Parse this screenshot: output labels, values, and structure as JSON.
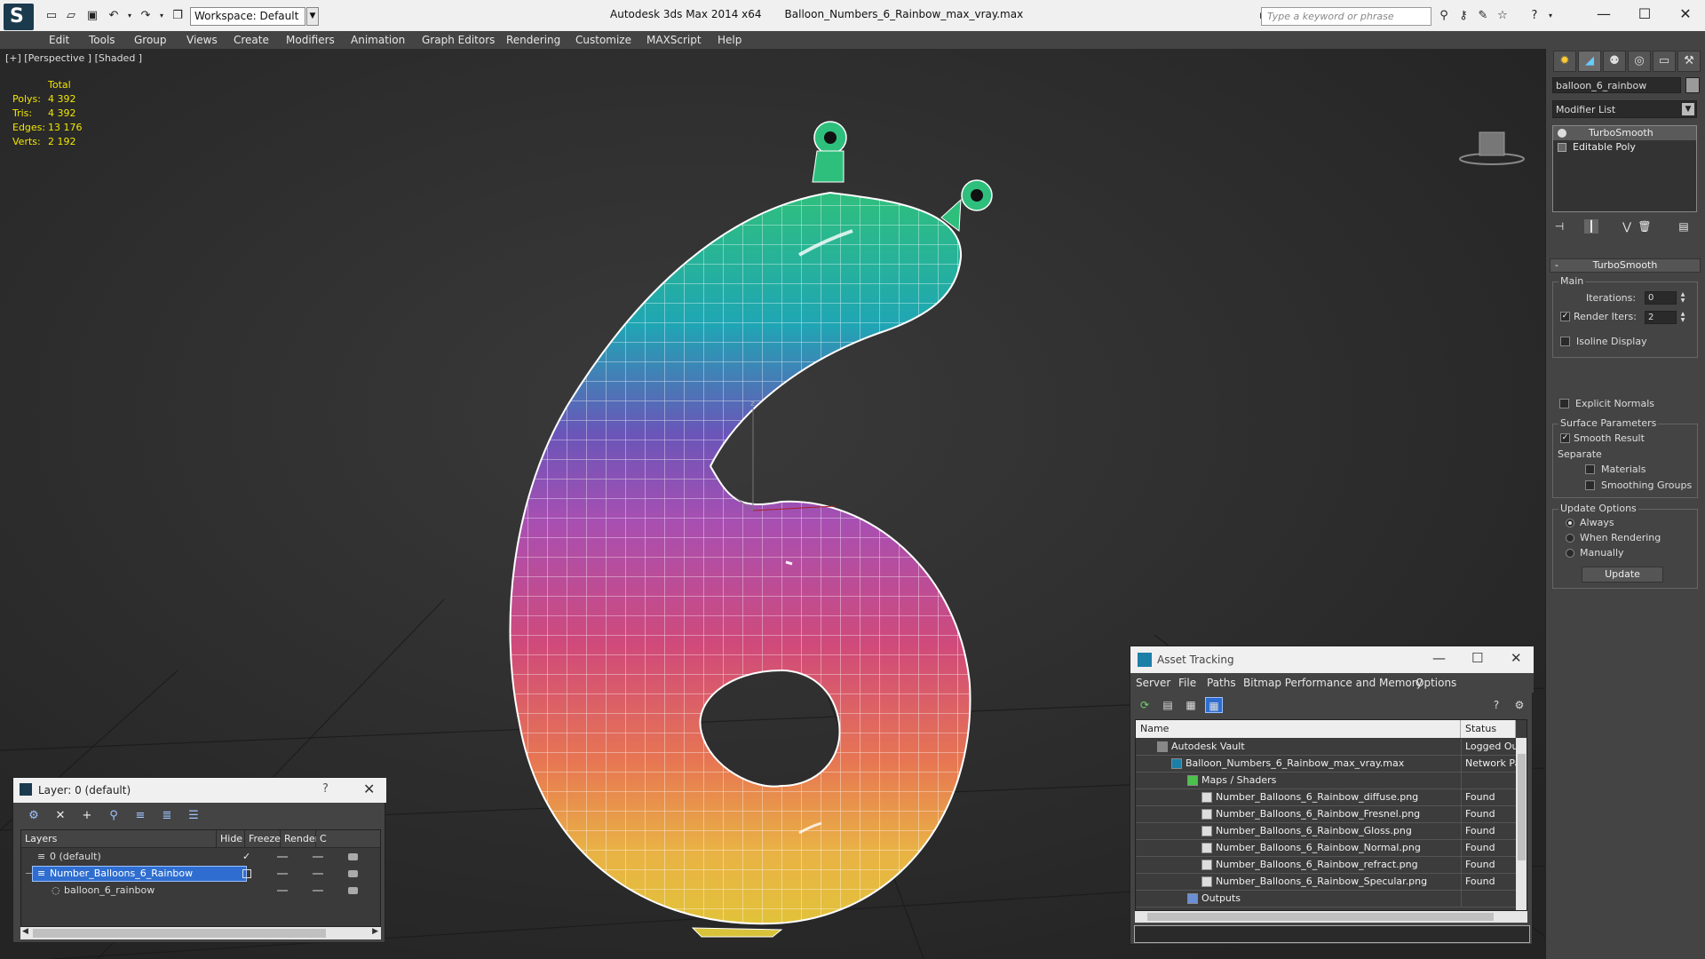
{
  "titlebar": {
    "workspace": "Workspace: Default",
    "app_name": "Autodesk 3ds Max  2014 x64",
    "file_name": "Balloon_Numbers_6_Rainbow_max_vray.max",
    "search_placeholder": "Type a keyword or phrase"
  },
  "menu": [
    "Edit",
    "Tools",
    "Group",
    "Views",
    "Create",
    "Modifiers",
    "Animation",
    "Graph Editors",
    "Rendering",
    "Customize",
    "MAXScript",
    "Help"
  ],
  "viewport": {
    "label": "[+] [Perspective ] [Shaded ]",
    "stats_header": "Total",
    "stats": [
      {
        "key": "Polys:",
        "value": "4 392"
      },
      {
        "key": "Tris:",
        "value": "4 392"
      },
      {
        "key": "Edges:",
        "value": "13 176"
      },
      {
        "key": "Verts:",
        "value": "2 192"
      }
    ],
    "gizmo_axis": "z"
  },
  "command_panel": {
    "object_name": "balloon_6_rainbow",
    "modifier_list": "Modifier List",
    "stack": [
      "TurboSmooth",
      "Editable Poly"
    ],
    "rollout_title": "TurboSmooth",
    "main_group": "Main",
    "iterations_label": "Iterations:",
    "iterations_value": "0",
    "render_iters_label": "Render Iters:",
    "render_iters_value": "2",
    "isoline_display": "Isoline Display",
    "explicit_normals": "Explicit Normals",
    "surface_group": "Surface Parameters",
    "smooth_result": "Smooth Result",
    "separate_label": "Separate",
    "materials": "Materials",
    "smoothing_groups": "Smoothing Groups",
    "update_group": "Update Options",
    "always": "Always",
    "when_rendering": "When Rendering",
    "manually": "Manually",
    "update_button": "Update"
  },
  "layer_dialog": {
    "title": "Layer: 0 (default)",
    "help": "?",
    "columns": [
      "Layers",
      "Hide",
      "Freeze",
      "Render",
      "C"
    ],
    "rows": [
      {
        "name": "0 (default)"
      },
      {
        "name": "Number_Balloons_6_Rainbow"
      },
      {
        "name": "balloon_6_rainbow"
      }
    ]
  },
  "asset_dialog": {
    "title": "Asset Tracking",
    "menu": [
      "Server",
      "File",
      "Paths",
      "Bitmap Performance and Memory",
      "Options"
    ],
    "columns": [
      "Name",
      "Status"
    ],
    "rows": [
      {
        "name": "Autodesk Vault",
        "status": "Logged Out"
      },
      {
        "name": "Balloon_Numbers_6_Rainbow_max_vray.max",
        "status": "Network Path"
      },
      {
        "name": "Maps / Shaders",
        "status": ""
      },
      {
        "name": "Number_Balloons_6_Rainbow_diffuse.png",
        "status": "Found"
      },
      {
        "name": "Number_Balloons_6_Rainbow_Fresnel.png",
        "status": "Found"
      },
      {
        "name": "Number_Balloons_6_Rainbow_Gloss.png",
        "status": "Found"
      },
      {
        "name": "Number_Balloons_6_Rainbow_Normal.png",
        "status": "Found"
      },
      {
        "name": "Number_Balloons_6_Rainbow_refract.png",
        "status": "Found"
      },
      {
        "name": "Number_Balloons_6_Rainbow_Specular.png",
        "status": "Found"
      },
      {
        "name": "Outputs",
        "status": ""
      }
    ]
  },
  "colors": {
    "stats": "#f2e600",
    "selection": "#2f6ed0",
    "viewport_bg": "#2c2c2c"
  }
}
